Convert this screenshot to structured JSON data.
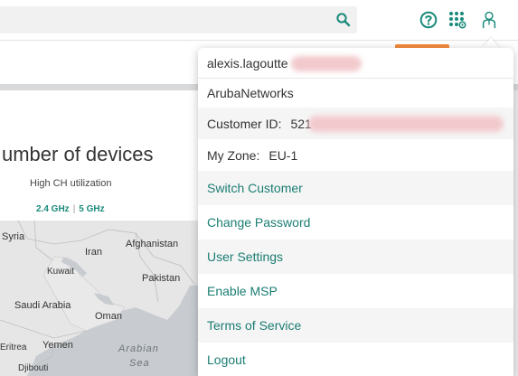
{
  "topbar": {
    "search_placeholder": "",
    "icons": [
      "search-icon",
      "help-icon",
      "apps-grid-icon",
      "user-icon"
    ],
    "accent": "#1b8a7a"
  },
  "card": {
    "title": "umber of devices",
    "subtitle": "High CH utilization",
    "band_24": "2.4 GHz",
    "band_sep": "|",
    "band_5": "5 GHz"
  },
  "map": {
    "labels": [
      "Syria",
      "Afghanistan",
      "Iran",
      "Kuwait",
      "Pakistan",
      "Saudi Arabia",
      "Oman",
      "Eritrea",
      "Yemen",
      "Djibouti"
    ],
    "sea_lines": [
      "Arabian",
      "Sea"
    ]
  },
  "dropdown": {
    "username": "alexis.lagoutte",
    "organization": "ArubaNetworks",
    "customer_id_label": "Customer ID:",
    "customer_id_value": "521",
    "zone_label": "My Zone:",
    "zone_value": "EU-1",
    "items": [
      "Switch Customer",
      "Change Password",
      "User Settings",
      "Enable MSP",
      "Terms of Service",
      "Logout"
    ]
  },
  "colors": {
    "link": "#1b7d73",
    "orange": "#f68b3b",
    "redaction": "#f2c9cd"
  }
}
